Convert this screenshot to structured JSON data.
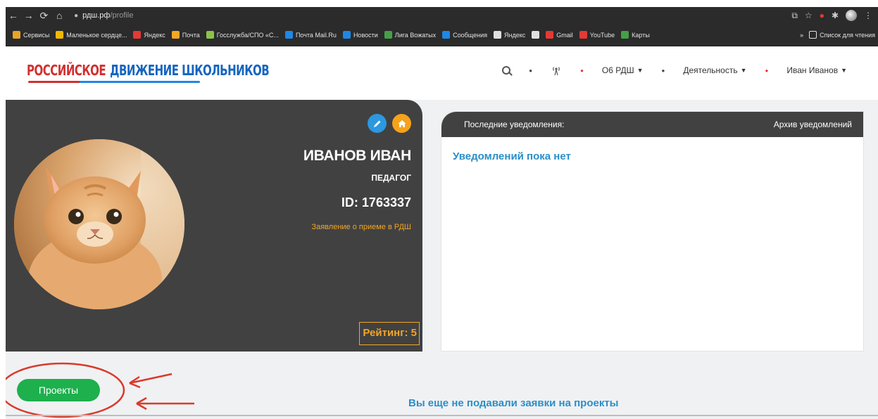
{
  "browser": {
    "url_host": "рдш.рф",
    "url_path": "/profile"
  },
  "bookmarks": [
    {
      "label": "Сервисы",
      "color": "#e8a427"
    },
    {
      "label": "Маленькое сердце...",
      "color": "#f1b800"
    },
    {
      "label": "Яндекс",
      "color": "#e53935"
    },
    {
      "label": "Почта",
      "color": "#f5a623"
    },
    {
      "label": "Госслужба/СПО «С...",
      "color": "#8bc34a"
    },
    {
      "label": "Почта Mail.Ru",
      "color": "#1e88e5"
    },
    {
      "label": "Новости",
      "color": "#1e88e5"
    },
    {
      "label": "Лига Вожатых",
      "color": "#43a047"
    },
    {
      "label": "Сообщения",
      "color": "#1e88e5"
    },
    {
      "label": "Яндекс",
      "color": "#e0e0e0"
    },
    {
      "label": "",
      "color": "#e0e0e0"
    },
    {
      "label": "Gmail",
      "color": "#e53935"
    },
    {
      "label": "YouTube",
      "color": "#e53935"
    },
    {
      "label": "Карты",
      "color": "#43a047"
    }
  ],
  "bookmarks_more": "»",
  "reading_list": "Список для чтения",
  "site": {
    "logo_red": "РОССИЙСКОЕ",
    "logo_blue": "ДВИЖЕНИЕ ШКОЛЬНИКОВ",
    "nav": {
      "about": "О6 РДШ",
      "activity": "Деятельность",
      "user": "Иван Иванов"
    }
  },
  "profile": {
    "name": "ИВАНОВ ИВАН",
    "role": "ПЕДАГОГ",
    "id": "ID: 1763337",
    "application_link": "Заявление о приеме в РДШ",
    "rating": "Рейтинг: 5"
  },
  "notifications": {
    "title": "Последние уведомления:",
    "archive": "Архив уведомлений",
    "empty": "Уведомлений пока нет"
  },
  "projects": {
    "button": "Проекты",
    "empty": "Вы еще не подавали заявки на проекты"
  },
  "colors": {
    "dark_panel": "#414141",
    "accent_orange": "#f4a623",
    "accent_blue": "#2a8fc7",
    "button_green": "#1db04d",
    "annotation_red": "#d93a2b"
  }
}
